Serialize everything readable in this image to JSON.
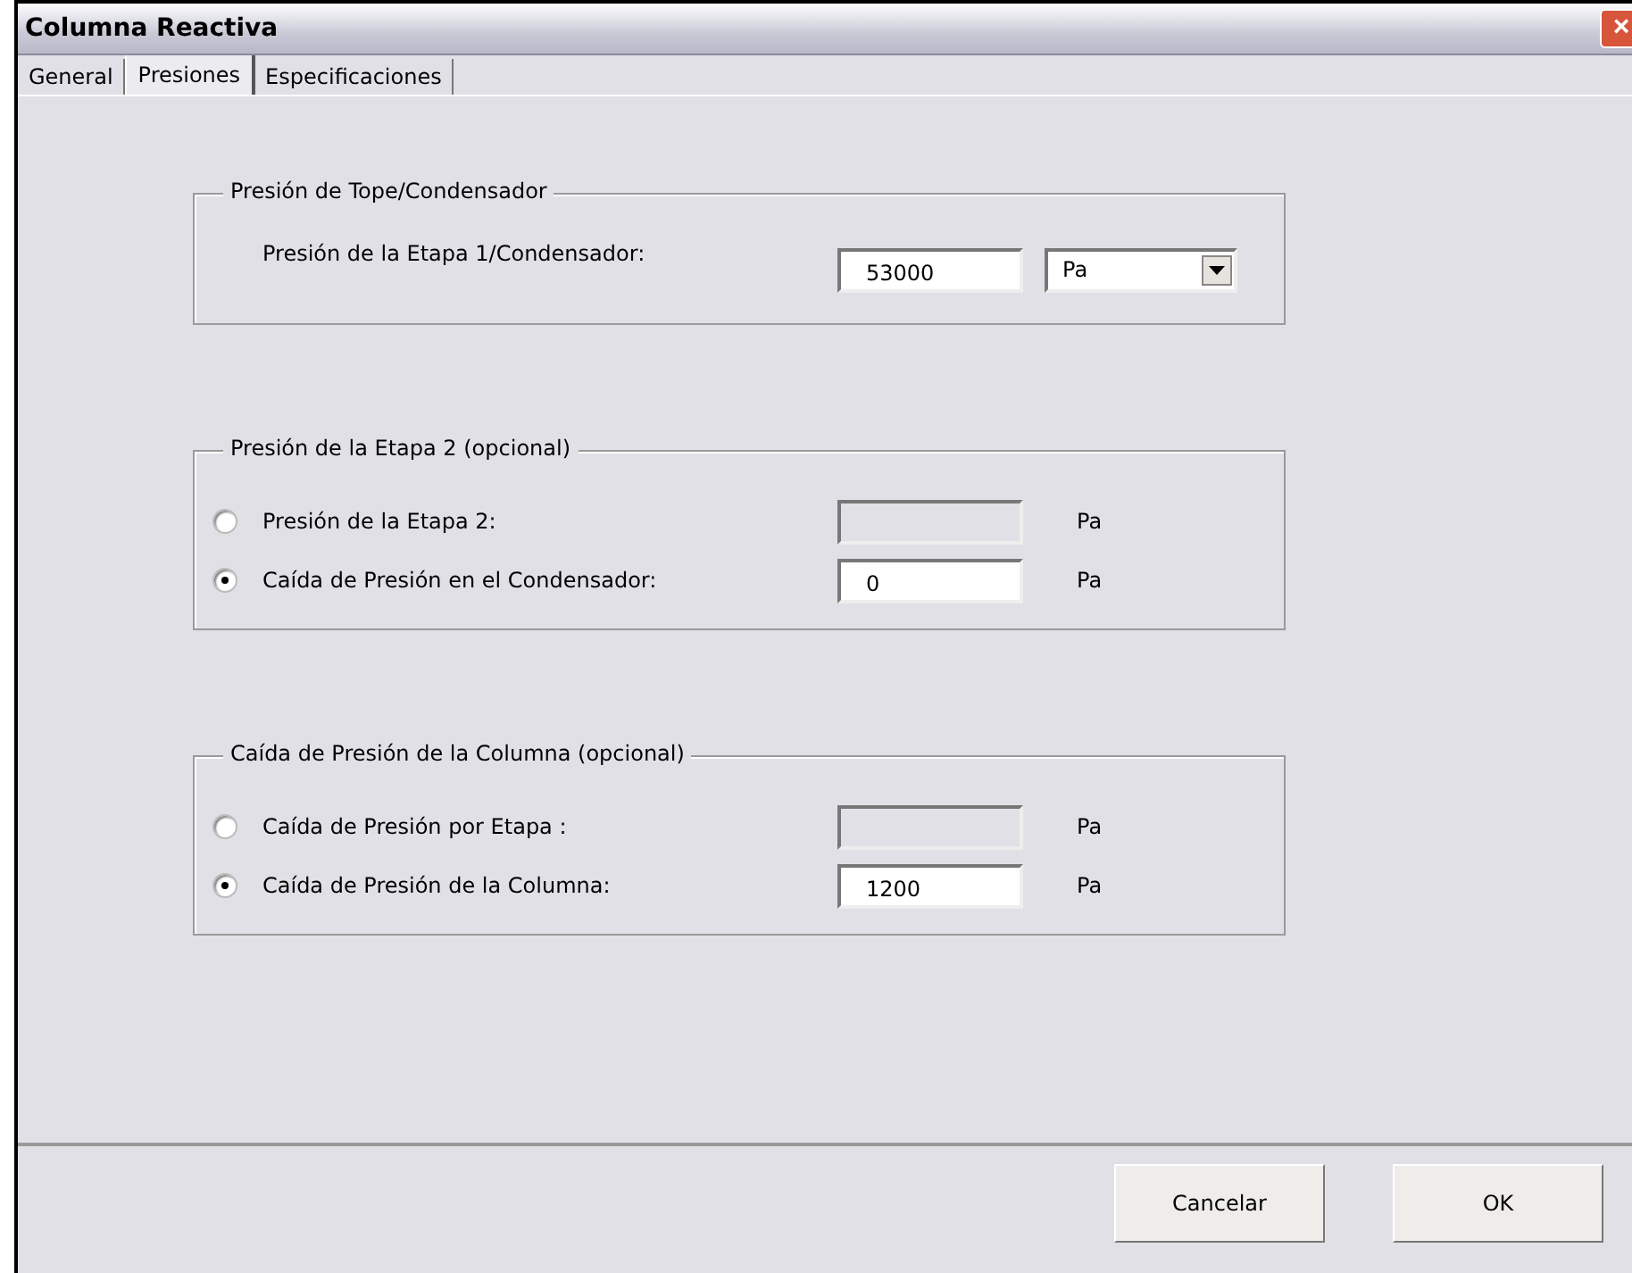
{
  "window": {
    "title": "Columna Reactiva",
    "close": "×"
  },
  "tabs": [
    {
      "label": "General",
      "selected": false
    },
    {
      "label": "Presiones",
      "selected": true
    },
    {
      "label": "Especificaciones",
      "selected": false
    }
  ],
  "groups": [
    {
      "title": "Presión de Tope/Condensador",
      "rows": [
        {
          "kind": "plain",
          "label": "Presión de la Etapa 1/Condensador:",
          "value": "53000",
          "unit_select": "Pa"
        }
      ]
    },
    {
      "title": "Presión de la Etapa 2 (opcional)",
      "rows": [
        {
          "kind": "radio",
          "selected": false,
          "label": "Presión de la Etapa 2:",
          "disabled": true,
          "unit": "Pa"
        },
        {
          "kind": "radio",
          "selected": true,
          "label": "Caída de Presión en el Condensador:",
          "disabled": false,
          "value": "0",
          "unit": "Pa"
        }
      ]
    },
    {
      "title": "Caída de Presión de la Columna (opcional)",
      "rows": [
        {
          "kind": "radio",
          "selected": false,
          "label": "Caída de Presión por Etapa :",
          "disabled": true,
          "unit": "Pa"
        },
        {
          "kind": "radio",
          "selected": true,
          "label": "Caída de Presión de la Columna:",
          "disabled": false,
          "value": "1200",
          "unit": "Pa"
        }
      ]
    }
  ],
  "buttons": [
    "Cancelar",
    "OK"
  ]
}
